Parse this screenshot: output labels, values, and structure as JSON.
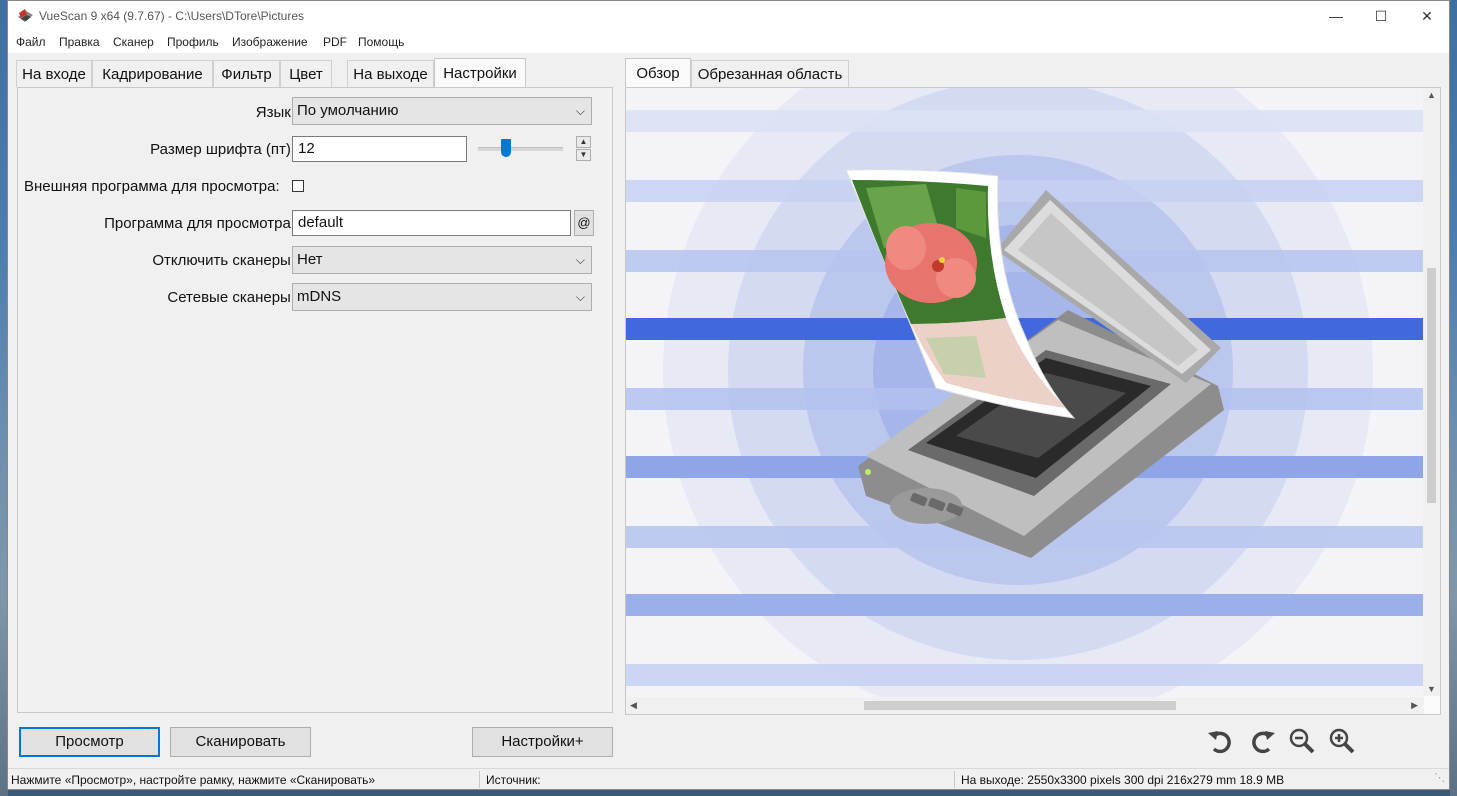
{
  "window": {
    "title": "VueScan 9 x64 (9.7.67) - C:\\Users\\DTore\\Pictures",
    "minimize_glyph": "—",
    "maximize_glyph": "☐",
    "close_glyph": "✕"
  },
  "menu": [
    "Файл",
    "Правка",
    "Сканер",
    "Профиль",
    "Изображение",
    "PDF",
    "Помощь"
  ],
  "left_tabs": [
    "На входе",
    "Кадрирование",
    "Фильтр",
    "Цвет",
    "На выходе",
    "Настройки"
  ],
  "active_left_tab": "Настройки",
  "settings": {
    "language_label": "Язык:",
    "language_value": "По умолчанию",
    "font_size_label": "Размер шрифта (пт):",
    "font_size_value": "12",
    "font_size_slider_fraction": 0.3,
    "external_viewer_label": "Внешняя программа для просмотра:",
    "external_viewer_checked": false,
    "viewer_program_label": "Программа для просмотра:",
    "viewer_program_value": "default",
    "at_button": "@",
    "disable_scanners_label": "Отключить сканеры:",
    "disable_scanners_value": "Нет",
    "network_scanners_label": "Сетевые сканеры:",
    "network_scanners_value": "mDNS"
  },
  "right_tabs": [
    "Обзор",
    "Обрезанная область"
  ],
  "active_right_tab": "Обзор",
  "buttons": {
    "preview": "Просмотр",
    "scan": "Сканировать",
    "more_settings": "Настройки+"
  },
  "toolbar_icons": [
    "rotate-left-icon",
    "rotate-right-icon",
    "zoom-out-icon",
    "zoom-in-icon"
  ],
  "status": {
    "hint": "Нажмите «Просмотр», настройте рамку, нажмите «Сканировать»",
    "source": "Источник:",
    "output": "На выходе: 2550x3300 pixels 300 dpi 216x279 mm 18.9 MB"
  },
  "colors": {
    "accent": "#0078d7",
    "stripe_blue": "#4168dc",
    "window_bg": "#f0f0f0"
  }
}
